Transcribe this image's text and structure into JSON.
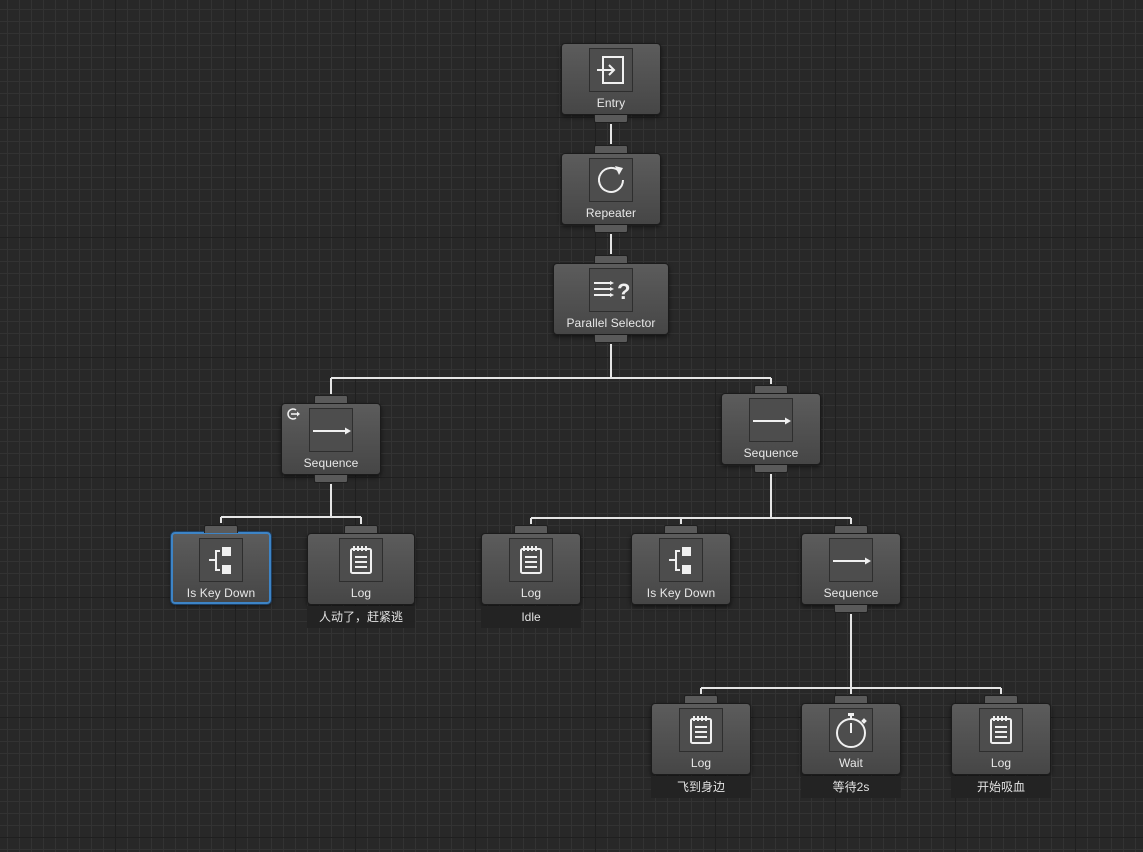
{
  "graph": {
    "nodes": [
      {
        "id": "entry",
        "title": "Entry",
        "icon": "entry-icon",
        "comment": null,
        "selected": false,
        "abort_badge": false
      },
      {
        "id": "repeater",
        "title": "Repeater",
        "icon": "repeat-icon",
        "comment": null,
        "selected": false,
        "abort_badge": false
      },
      {
        "id": "parallel_selector",
        "title": "Parallel Selector",
        "icon": "parallel-selector-icon",
        "comment": null,
        "selected": false,
        "abort_badge": false
      },
      {
        "id": "sequence_left",
        "title": "Sequence",
        "icon": "arrow-right-icon",
        "comment": null,
        "selected": false,
        "abort_badge": true
      },
      {
        "id": "sequence_right",
        "title": "Sequence",
        "icon": "arrow-right-icon",
        "comment": null,
        "selected": false,
        "abort_badge": false
      },
      {
        "id": "is_key_down_1",
        "title": "Is Key Down",
        "icon": "conditional-icon",
        "comment": null,
        "selected": true,
        "abort_badge": false
      },
      {
        "id": "log_1",
        "title": "Log",
        "icon": "log-icon",
        "comment": "人动了，赶紧逃",
        "selected": false,
        "abort_badge": false
      },
      {
        "id": "log_idle",
        "title": "Log",
        "icon": "log-icon",
        "comment": "Idle",
        "selected": false,
        "abort_badge": false
      },
      {
        "id": "is_key_down_2",
        "title": "Is Key Down",
        "icon": "conditional-icon",
        "comment": null,
        "selected": false,
        "abort_badge": false
      },
      {
        "id": "sequence_inner",
        "title": "Sequence",
        "icon": "arrow-right-icon",
        "comment": null,
        "selected": false,
        "abort_badge": false
      },
      {
        "id": "log_fly",
        "title": "Log",
        "icon": "log-icon",
        "comment": "飞到身边",
        "selected": false,
        "abort_badge": false
      },
      {
        "id": "wait",
        "title": "Wait",
        "icon": "stopwatch-icon",
        "comment": "等待2s",
        "selected": false,
        "abort_badge": false
      },
      {
        "id": "log_blood",
        "title": "Log",
        "icon": "log-icon",
        "comment": "开始吸血",
        "selected": false,
        "abort_badge": false
      }
    ],
    "edges": [
      [
        "entry",
        "repeater"
      ],
      [
        "repeater",
        "parallel_selector"
      ],
      [
        "parallel_selector",
        "sequence_left"
      ],
      [
        "parallel_selector",
        "sequence_right"
      ],
      [
        "sequence_left",
        "is_key_down_1"
      ],
      [
        "sequence_left",
        "log_1"
      ],
      [
        "sequence_right",
        "log_idle"
      ],
      [
        "sequence_right",
        "is_key_down_2"
      ],
      [
        "sequence_right",
        "sequence_inner"
      ],
      [
        "sequence_inner",
        "log_fly"
      ],
      [
        "sequence_inner",
        "wait"
      ],
      [
        "sequence_inner",
        "log_blood"
      ]
    ]
  }
}
